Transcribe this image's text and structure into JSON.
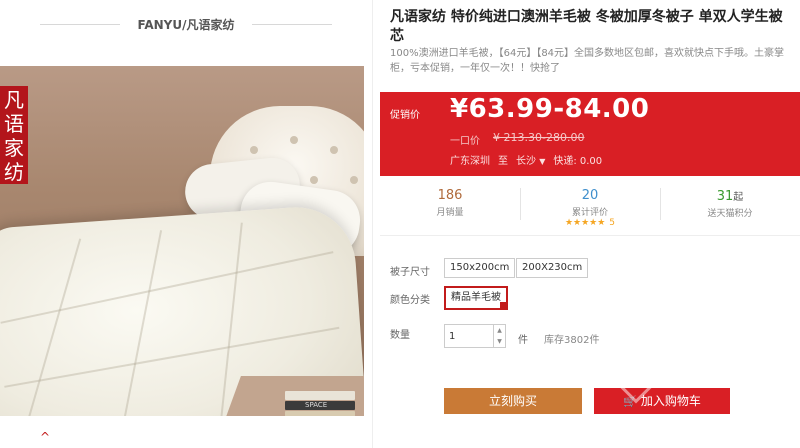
{
  "gallery": {
    "brand_title": "FANYU/凡语家纺",
    "side_label": [
      "凡",
      "语",
      "家",
      "纺"
    ],
    "book_labels": [
      "SPACE"
    ]
  },
  "product": {
    "title": "凡语家纺 特价纯进口澳洲羊毛被 冬被加厚冬被子 单双人学生被芯",
    "subtitle": "100%澳洲进口羊毛被，【64元】【84元】全国多数地区包邮，喜欢就快点下手哦。土豪掌柜，亏本促销，一年仅一次！！快抢了"
  },
  "price": {
    "label": "促销价",
    "value": "¥63.99-84.00",
    "original_label": "一口价",
    "original_value": "¥ 213.30-280.00",
    "ship_from": "广东深圳",
    "ship_to_word": "至",
    "ship_to": "长沙",
    "shipping": "快递: 0.00"
  },
  "stats": {
    "sales_num": "186",
    "sales_label": "月销量",
    "review_num": "20",
    "review_label": "累计评价",
    "review_stars": "★★★★★",
    "review_score": "5",
    "points_num": "31",
    "points_unit": "起",
    "points_label": "送天猫积分"
  },
  "options": {
    "size_label": "被子尺寸",
    "sizes": [
      "150x200cm",
      "200X230cm"
    ],
    "color_label": "颜色分类",
    "color_selected": "精品羊毛被"
  },
  "quantity": {
    "label": "数量",
    "value": "1",
    "unit": "件",
    "stock": "库存3802件"
  },
  "actions": {
    "buy_label": "立刻购买",
    "cart_label": "加入购物车"
  },
  "colors": {
    "accent_red": "#d91f25",
    "buy_orange": "#c97a36",
    "brand_red": "#b3151b"
  }
}
